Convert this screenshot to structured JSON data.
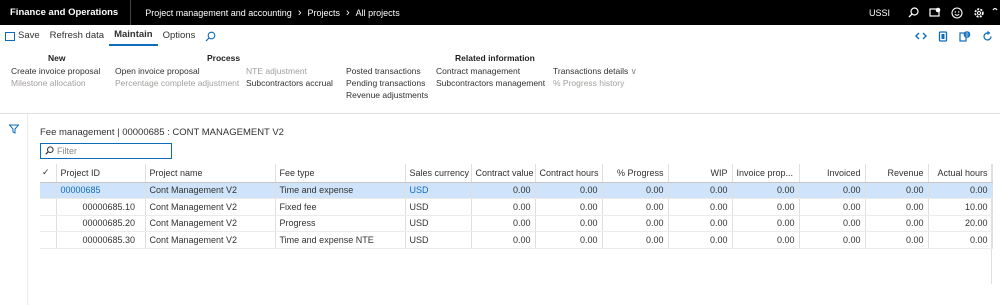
{
  "topbar": {
    "app_name": "Finance and Operations",
    "breadcrumb": [
      "Project management and accounting",
      "Projects",
      "All projects"
    ],
    "company": "USSI"
  },
  "actionbar": {
    "save": "Save",
    "refresh": "Refresh data",
    "maintain": "Maintain",
    "options": "Options"
  },
  "ribbon": {
    "new": {
      "title": "New",
      "items": [
        "Create invoice proposal",
        "Milestone allocation"
      ]
    },
    "process": {
      "title": "Process",
      "items": [
        "Open invoice proposal",
        "Percentage complete adjustment",
        "NTE adjustment",
        "Subcontractors accrual"
      ]
    },
    "related": {
      "title": "Related information",
      "items": [
        "Posted transactions",
        "Pending transactions",
        "Revenue adjustments",
        "Contract management",
        "Subcontractors management",
        "Transactions details",
        "% Progress history"
      ]
    }
  },
  "page": {
    "title": "Fee management  |  00000685 : CONT MANAGEMENT V2",
    "filter_placeholder": "Filter"
  },
  "grid": {
    "columns": [
      "Project ID",
      "Project name",
      "Fee type",
      "Sales currency",
      "Contract value",
      "Contract hours",
      "% Progress",
      "WIP",
      "Invoice prop...",
      "Invoiced",
      "Revenue",
      "Actual hours"
    ],
    "rows": [
      [
        "00000685",
        "Cont Management V2",
        "Time and expense",
        "USD",
        "0.00",
        "0.00",
        "0.00",
        "0.00",
        "0.00",
        "0.00",
        "0.00",
        "0.00"
      ],
      [
        "00000685.10",
        "Cont Management V2",
        "Fixed fee",
        "USD",
        "0.00",
        "0.00",
        "0.00",
        "0.00",
        "0.00",
        "0.00",
        "0.00",
        "10.00"
      ],
      [
        "00000685.20",
        "Cont Management V2",
        "Progress",
        "USD",
        "0.00",
        "0.00",
        "0.00",
        "0.00",
        "0.00",
        "0.00",
        "0.00",
        "20.00"
      ],
      [
        "00000685.30",
        "Cont Management V2",
        "Time and expense NTE",
        "USD",
        "0.00",
        "0.00",
        "0.00",
        "0.00",
        "0.00",
        "0.00",
        "0.00",
        "0.00"
      ]
    ]
  },
  "colors": {
    "accent": "#0f6cbd",
    "selected_row": "#cfe4fa",
    "topbar": "#000000"
  }
}
